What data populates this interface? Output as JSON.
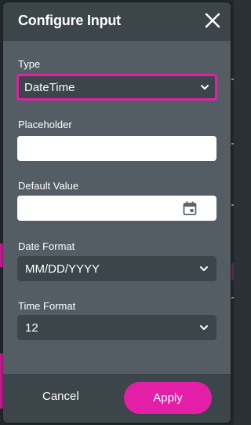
{
  "dialog": {
    "title": "Configure Input",
    "close_icon": "close-icon"
  },
  "fields": {
    "type": {
      "label": "Type",
      "value": "DateTime"
    },
    "placeholder": {
      "label": "Placeholder",
      "value": ""
    },
    "default_value": {
      "label": "Default Value",
      "value": ""
    },
    "date_format": {
      "label": "Date Format",
      "value": "MM/DD/YYYY"
    },
    "time_format": {
      "label": "Time Format",
      "value": "12"
    }
  },
  "footer": {
    "cancel_label": "Cancel",
    "apply_label": "Apply"
  },
  "colors": {
    "accent": "#e31fa7",
    "panel": "#535d63",
    "header": "#3c454a",
    "field_dark": "#3c454a",
    "text": "#ffffff"
  }
}
